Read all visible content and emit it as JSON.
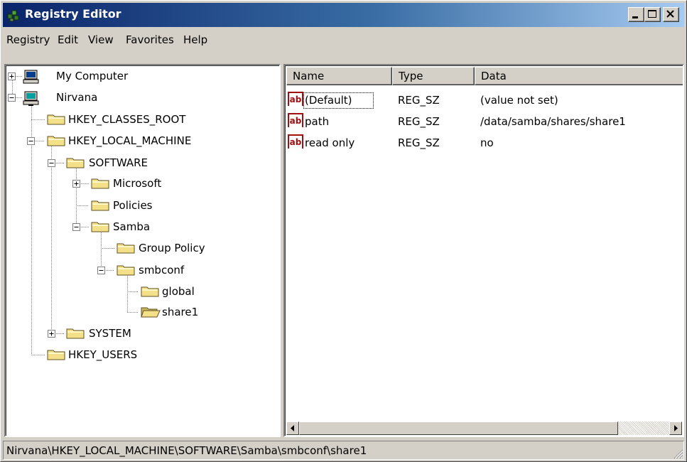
{
  "window": {
    "title": "Registry Editor",
    "title_icon": "regedit-icon",
    "controls": {
      "minimize": "minimize-icon",
      "maximize": "maximize-icon",
      "close": "close-icon"
    }
  },
  "menu": [
    "Registry",
    "Edit",
    "View",
    "Favorites",
    "Help"
  ],
  "tree": {
    "nodes": [
      {
        "label": "My Computer",
        "expander": "+",
        "icon": "computer-icon",
        "depth": 0
      },
      {
        "label": "Nirvana",
        "expander": "-",
        "icon": "network-computer-icon",
        "depth": 0
      },
      {
        "label": "HKEY_CLASSES_ROOT",
        "expander": "",
        "icon": "folder-icon",
        "depth": 1
      },
      {
        "label": "HKEY_LOCAL_MACHINE",
        "expander": "-",
        "icon": "folder-icon",
        "depth": 1
      },
      {
        "label": "SOFTWARE",
        "expander": "-",
        "icon": "folder-icon",
        "depth": 2
      },
      {
        "label": "Microsoft",
        "expander": "+",
        "icon": "folder-icon",
        "depth": 3
      },
      {
        "label": "Policies",
        "expander": "",
        "icon": "folder-icon",
        "depth": 3
      },
      {
        "label": "Samba",
        "expander": "-",
        "icon": "folder-icon",
        "depth": 3
      },
      {
        "label": "Group Policy",
        "expander": "",
        "icon": "folder-icon",
        "depth": 4
      },
      {
        "label": "smbconf",
        "expander": "-",
        "icon": "folder-icon",
        "depth": 4
      },
      {
        "label": "global",
        "expander": "",
        "icon": "folder-icon",
        "depth": 5
      },
      {
        "label": "share1",
        "expander": "",
        "icon": "open-folder-icon",
        "depth": 5
      },
      {
        "label": "SYSTEM",
        "expander": "+",
        "icon": "folder-icon",
        "depth": 2
      },
      {
        "label": "HKEY_USERS",
        "expander": "",
        "icon": "folder-icon",
        "depth": 1
      }
    ]
  },
  "list": {
    "columns": [
      "Name",
      "Type",
      "Data"
    ],
    "rows": [
      {
        "icon": "string-value-icon",
        "name": "(Default)",
        "type": "REG_SZ",
        "data": "(value not set)"
      },
      {
        "icon": "string-value-icon",
        "name": "path",
        "type": "REG_SZ",
        "data": "/data/samba/shares/share1"
      },
      {
        "icon": "string-value-icon",
        "name": "read only",
        "type": "REG_SZ",
        "data": "no"
      }
    ]
  },
  "status": {
    "path": "Nirvana\\HKEY_LOCAL_MACHINE\\SOFTWARE\\Samba\\smbconf\\share1"
  },
  "colors": {
    "title_gradient_start": "#0a246a",
    "title_gradient_end": "#a6caf0",
    "face": "#d4d0c8",
    "folder": "#f5e08a",
    "value_icon": "#a01010"
  }
}
